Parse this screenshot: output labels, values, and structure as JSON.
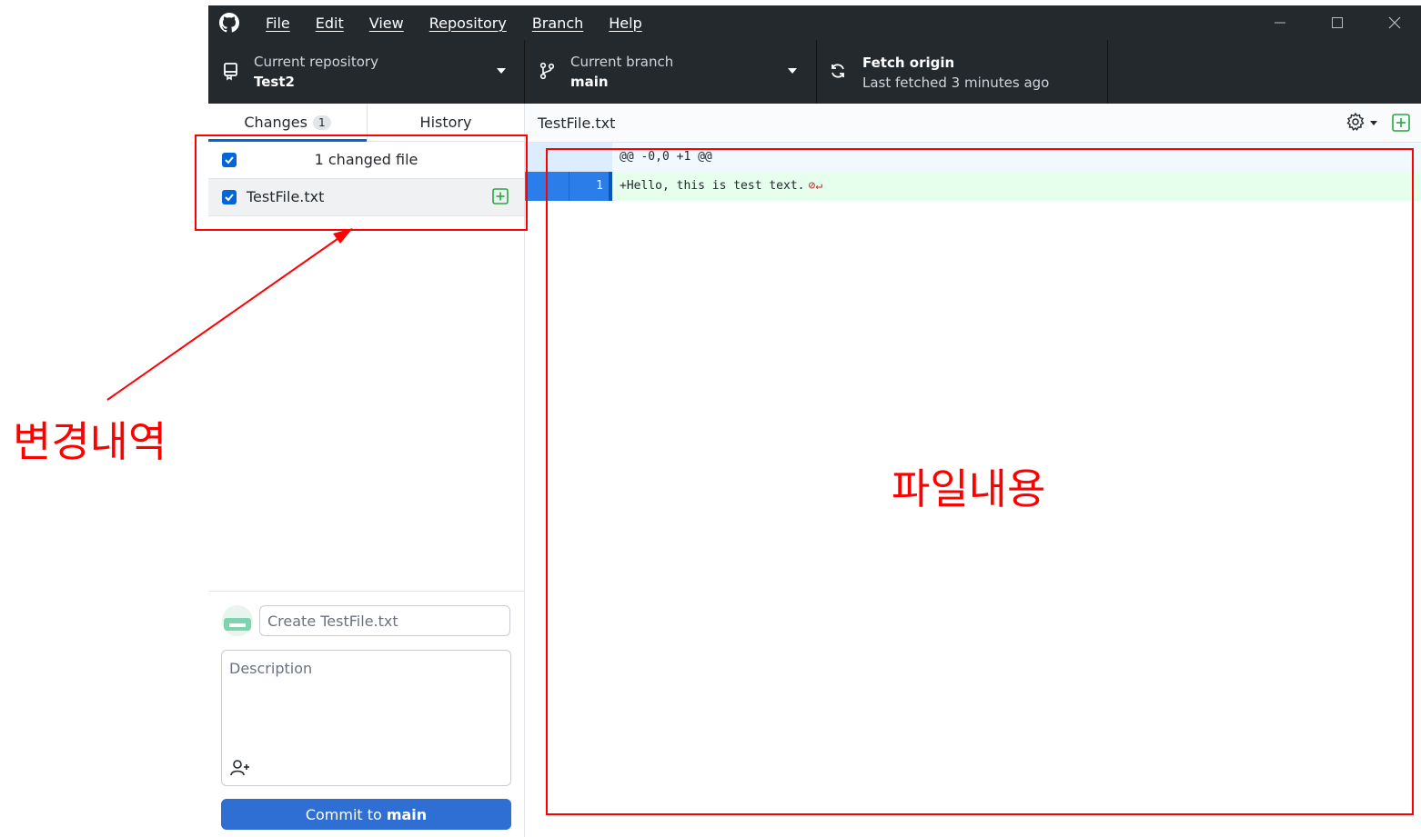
{
  "menu": [
    "File",
    "Edit",
    "View",
    "Repository",
    "Branch",
    "Help"
  ],
  "toolbar": {
    "repo_sub": "Current repository",
    "repo_main": "Test2",
    "branch_sub": "Current branch",
    "branch_main": "main",
    "fetch_main": "Fetch origin",
    "fetch_sub": "Last fetched 3 minutes ago"
  },
  "tabs": {
    "changes_label": "Changes",
    "changes_count": "1",
    "history_label": "History"
  },
  "changes": {
    "header": "1 changed file",
    "files": [
      {
        "name": "TestFile.txt",
        "status": "added"
      }
    ]
  },
  "commit": {
    "summary_placeholder": "Create TestFile.txt",
    "description_placeholder": "Description",
    "button_prefix": "Commit to",
    "button_branch": "main"
  },
  "diff": {
    "file": "TestFile.txt",
    "hunk": "@@ -0,0 +1 @@",
    "lines": [
      {
        "number": "1",
        "text": "+Hello, this is test text."
      }
    ]
  },
  "annotations": {
    "changes_label": "변경내역",
    "content_label": "파일내용",
    "color": "#ff0000"
  }
}
